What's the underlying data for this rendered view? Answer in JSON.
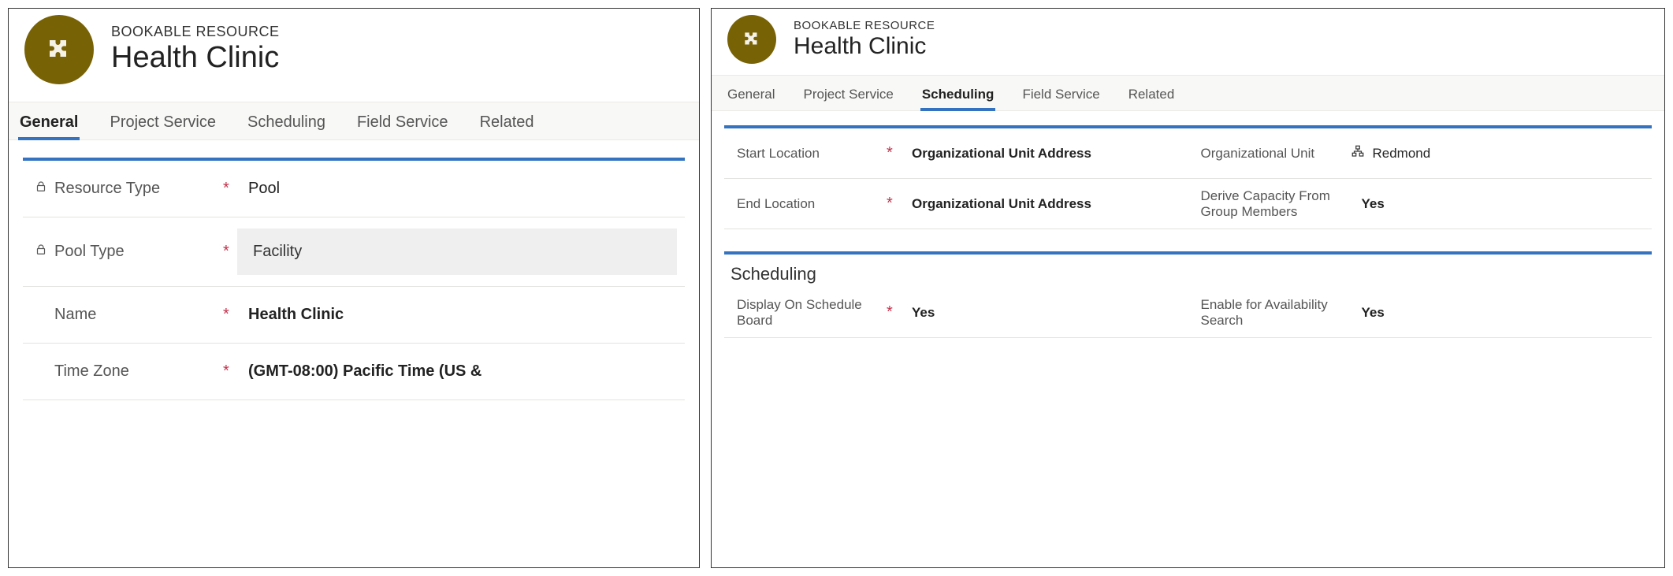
{
  "left": {
    "eyebrow": "BOOKABLE RESOURCE",
    "title": "Health Clinic",
    "tabs": [
      "General",
      "Project Service",
      "Scheduling",
      "Field Service",
      "Related"
    ],
    "active_tab": 0,
    "fields": {
      "resource_type": {
        "label": "Resource Type",
        "value": "Pool",
        "locked": true,
        "required": true
      },
      "pool_type": {
        "label": "Pool Type",
        "value": "Facility",
        "locked": true,
        "required": true
      },
      "name": {
        "label": "Name",
        "value": "Health Clinic",
        "required": true
      },
      "time_zone": {
        "label": "Time Zone",
        "value": "(GMT-08:00) Pacific Time (US &",
        "required": true
      }
    }
  },
  "right": {
    "eyebrow": "BOOKABLE RESOURCE",
    "title": "Health Clinic",
    "tabs": [
      "General",
      "Project Service",
      "Scheduling",
      "Field Service",
      "Related"
    ],
    "active_tab": 2,
    "section1": {
      "start_location": {
        "label": "Start Location",
        "value": "Organizational Unit Address",
        "required": true
      },
      "end_location": {
        "label": "End Location",
        "value": "Organizational Unit Address",
        "required": true
      },
      "org_unit": {
        "label": "Organizational Unit",
        "value": "Redmond"
      },
      "derive_capacity": {
        "label": "Derive Capacity From Group Members",
        "value": "Yes"
      }
    },
    "section2": {
      "title": "Scheduling",
      "display_on_board": {
        "label": "Display On Schedule Board",
        "value": "Yes",
        "required": true
      },
      "enable_search": {
        "label": "Enable for Availability Search",
        "value": "Yes"
      }
    }
  }
}
